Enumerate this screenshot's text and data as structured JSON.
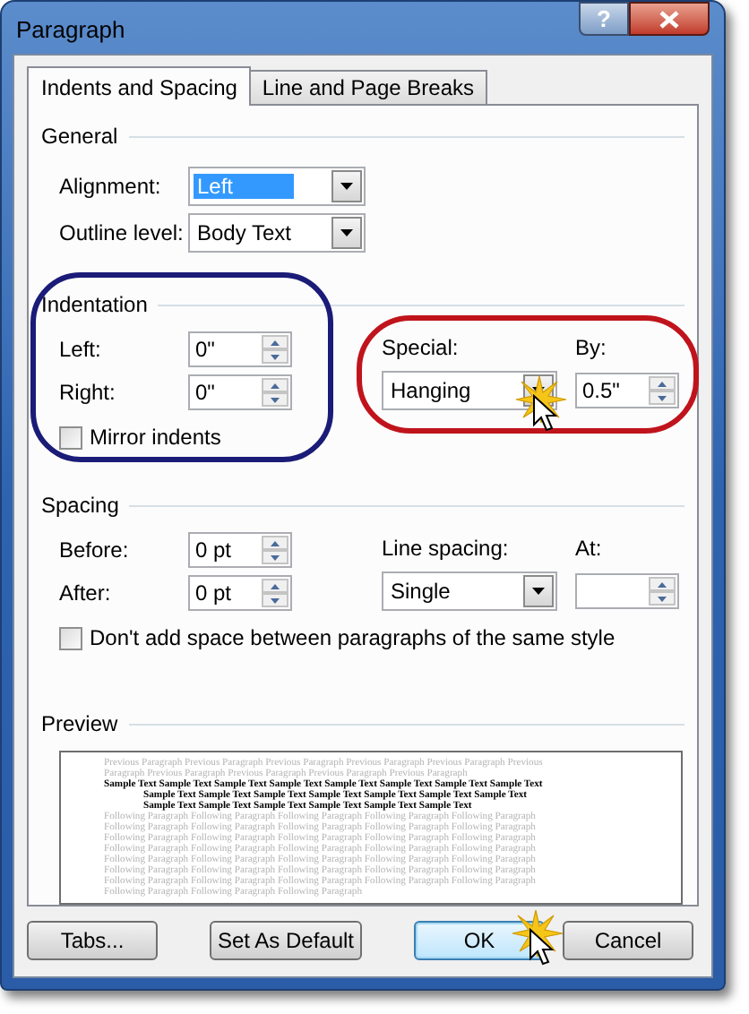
{
  "window": {
    "title": "Paragraph",
    "help": "?"
  },
  "tabs": [
    {
      "label": "Indents and Spacing",
      "selected": true
    },
    {
      "label": "Line and Page Breaks",
      "selected": false
    }
  ],
  "general": {
    "label": "General",
    "fields": [
      {
        "label": "Alignment:",
        "kind": "dropdown",
        "value": "Left",
        "highlighted": true
      },
      {
        "label": "Outline level:",
        "kind": "dropdown",
        "value": "Body Text",
        "highlighted": false
      }
    ]
  },
  "indentation": {
    "label": "Indentation",
    "left": {
      "label": "Left:",
      "value": "0\""
    },
    "right": {
      "label": "Right:",
      "value": "0\""
    },
    "mirror": {
      "label": "Mirror indents",
      "checked": false
    },
    "special": {
      "label": "Special:",
      "value": "Hanging"
    },
    "by": {
      "label": "By:",
      "value": "0.5\""
    }
  },
  "spacing": {
    "label": "Spacing",
    "before": {
      "label": "Before:",
      "value": "0 pt"
    },
    "after": {
      "label": "After:",
      "value": "0 pt"
    },
    "line_spacing": {
      "label": "Line spacing:",
      "value": "Single"
    },
    "at": {
      "label": "At:"
    },
    "no_space": {
      "label": "Don't add space between paragraphs of the same style",
      "checked": false
    }
  },
  "preview": {
    "label": "Preview",
    "lines": [
      {
        "kind": "previous",
        "text": "Previous Paragraph Previous Paragraph Previous Paragraph Previous Paragraph Previous Paragraph Previous"
      },
      {
        "kind": "previous",
        "text": "Paragraph Previous Paragraph Previous Paragraph Previous Paragraph Previous Paragraph"
      },
      {
        "kind": "sample_first",
        "text": "Sample Text Sample Text Sample Text Sample Text Sample Text Sample Text Sample Text Sample Text"
      },
      {
        "kind": "sample",
        "text": "Sample Text Sample Text Sample Text Sample Text Sample Text Sample Text Sample Text"
      },
      {
        "kind": "sample",
        "text": "Sample Text Sample Text Sample Text Sample Text Sample Text Sample Text"
      },
      {
        "kind": "following",
        "text": "Following Paragraph Following Paragraph Following Paragraph Following Paragraph Following Paragraph"
      },
      {
        "kind": "following",
        "text": "Following Paragraph Following Paragraph Following Paragraph Following Paragraph Following Paragraph"
      },
      {
        "kind": "following",
        "text": "Following Paragraph Following Paragraph Following Paragraph Following Paragraph Following Paragraph"
      },
      {
        "kind": "following",
        "text": "Following Paragraph Following Paragraph Following Paragraph Following Paragraph Following Paragraph"
      },
      {
        "kind": "following",
        "text": "Following Paragraph Following Paragraph Following Paragraph Following Paragraph Following Paragraph"
      },
      {
        "kind": "following",
        "text": "Following Paragraph Following Paragraph Following Paragraph Following Paragraph Following Paragraph"
      },
      {
        "kind": "following",
        "text": "Following Paragraph Following Paragraph Following Paragraph Following Paragraph Following Paragraph"
      },
      {
        "kind": "following",
        "text": "Following Paragraph Following Paragraph Following Paragraph"
      }
    ]
  },
  "buttons": [
    {
      "label": "Tabs...",
      "default": false
    },
    {
      "label": "Set As Default",
      "default": false
    },
    {
      "label": "OK",
      "default": true
    },
    {
      "label": "Cancel",
      "default": false
    }
  ],
  "annotations": [
    {
      "kind": "outline",
      "color": "#1b1b78"
    },
    {
      "kind": "outline",
      "color": "#c0141c"
    },
    {
      "kind": "click"
    },
    {
      "kind": "click"
    }
  ]
}
